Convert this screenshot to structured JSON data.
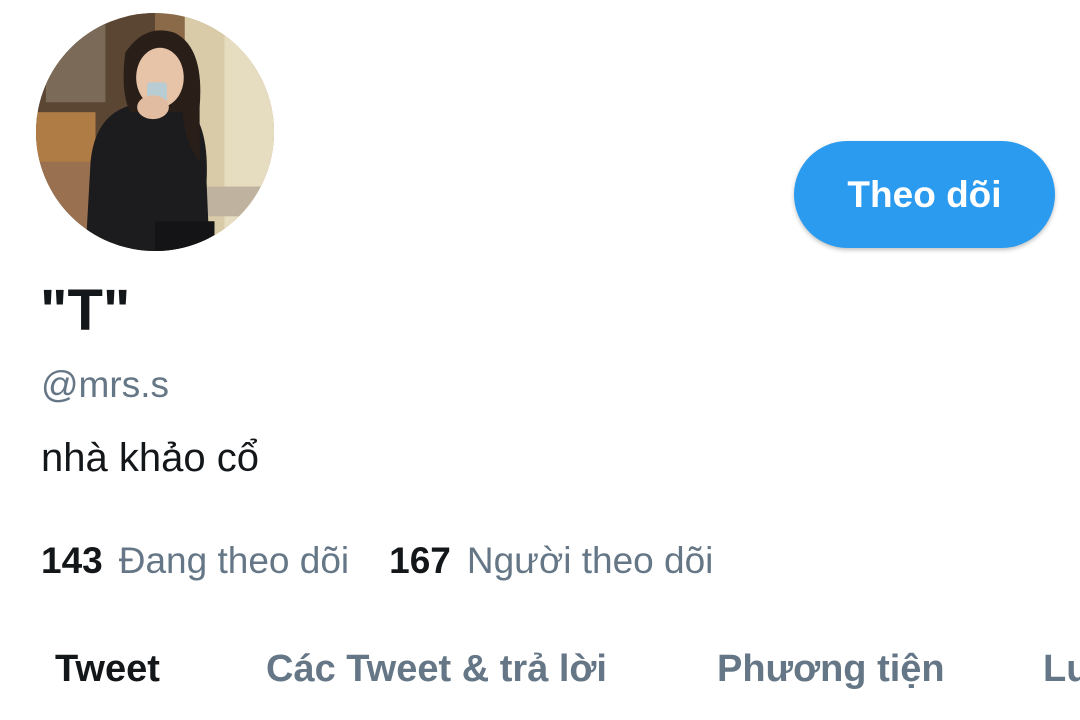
{
  "profile": {
    "display_name": "\"T\"",
    "handle": "@mrs.s",
    "bio": "nhà khảo cổ",
    "avatar_icon": "profile-photo"
  },
  "actions": {
    "follow_label": "Theo dõi"
  },
  "stats": {
    "following_count": "143",
    "following_label": "Đang theo dõi",
    "followers_count": "167",
    "followers_label": "Người theo dõi"
  },
  "tabs": [
    {
      "label": "Tweet",
      "active": true
    },
    {
      "label": "Các Tweet & trả lời",
      "active": false
    },
    {
      "label": "Phương tiện",
      "active": false
    },
    {
      "label": "Lư",
      "active": false
    }
  ],
  "colors": {
    "accent": "#2b9bf0",
    "text_primary": "#14171a",
    "text_secondary": "#657786"
  }
}
